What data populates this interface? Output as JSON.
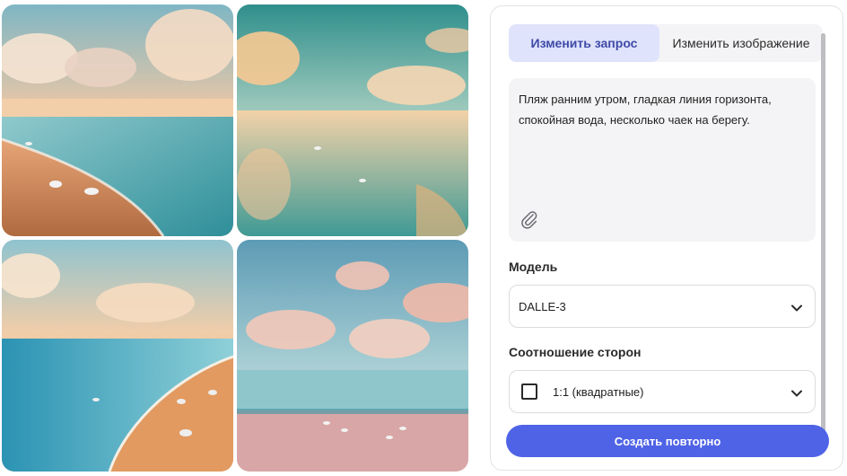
{
  "gallery": {
    "images": [
      {
        "name": "beach-image-1"
      },
      {
        "name": "beach-image-2"
      },
      {
        "name": "beach-image-3"
      },
      {
        "name": "beach-image-4"
      }
    ]
  },
  "panel": {
    "tabs": [
      {
        "label": "Изменить запрос",
        "active": true
      },
      {
        "label": "Изменить изображение",
        "active": false
      }
    ],
    "prompt": {
      "text": "Пляж ранним утром, гладкая линия горизонта, спокойная вода, несколько чаек на берегу.",
      "attach_icon": "paperclip-icon"
    },
    "model": {
      "label": "Модель",
      "value": "DALLE-3",
      "icon": "chevron-down-icon"
    },
    "aspect_ratio": {
      "label": "Соотношение сторон",
      "value": "1:1 (квадратные)",
      "icon": "square-ratio-icon"
    },
    "create_button": "Создать повторно"
  },
  "colors": {
    "accent": "#4f63e6",
    "tab_active_bg": "#dfe3fb",
    "tab_active_text": "#3f4aa8",
    "panel_bg": "#f4f4f6"
  }
}
